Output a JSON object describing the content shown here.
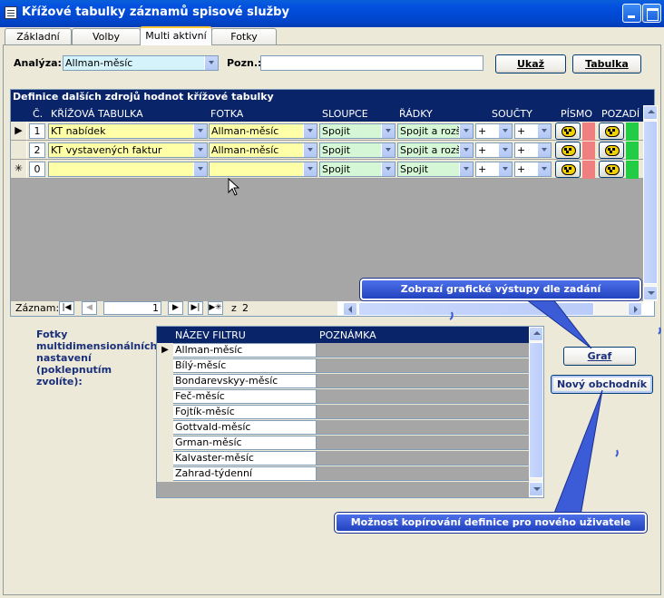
{
  "window": {
    "title": "Křížové tabulky záznamů spisové služby"
  },
  "tabs": [
    {
      "label": "Základní"
    },
    {
      "label": "Volby"
    },
    {
      "label": "Multi aktivní"
    },
    {
      "label": "Fotky"
    }
  ],
  "top": {
    "analyza_label": "Analýza:",
    "analyza_value": "Allman-měsíc",
    "pozn_label": "Pozn.:",
    "pozn_value": "",
    "ukaz_label": "Ukaž",
    "tabulka_label": "Tabulka"
  },
  "subform": {
    "title": "Definice dalších zdrojů hodnot křížové tabulky",
    "columns": {
      "c": "Č.",
      "krizova": "KŘÍŽOVÁ TABULKA",
      "fotka": "FOTKA",
      "sloupce": "SLOUPCE",
      "radky": "ŘÁDKY",
      "soucty": "SOUČTY",
      "pismo": "PÍSMO",
      "pozadi": "POZADÍ"
    },
    "rows": [
      {
        "selector": "▶",
        "num": "1",
        "krizova": "KT nabídek",
        "fotka": "Allman-měsíc",
        "sloupce": "Spojit",
        "radky": "Spojit a rozšíř",
        "soucet1": "+",
        "soucet2": "+"
      },
      {
        "selector": "",
        "num": "2",
        "krizova": "KT vystavených faktur",
        "fotka": "Allman-měsíc",
        "sloupce": "Spojit",
        "radky": "Spojit a rozšíř",
        "soucet1": "+",
        "soucet2": "+"
      },
      {
        "selector": "✳",
        "num": "0",
        "krizova": "",
        "fotka": "",
        "sloupce": "Spojit",
        "radky": "Spojit",
        "soucet1": "+",
        "soucet2": "+"
      }
    ],
    "nav": {
      "label": "Záznam:",
      "current": "1",
      "of": "z",
      "total": "2"
    }
  },
  "fotky": {
    "label": "Fotky multidimensionálních nastavení (poklepnutím zvolíte):",
    "columns": {
      "name": "NÁZEV FILTRU",
      "note": "POZNÁMKA"
    },
    "rows": [
      {
        "name": "Allman-měsíc",
        "selected": true
      },
      {
        "name": "Bílý-měsíc"
      },
      {
        "name": "Bondarevskyy-měsíc"
      },
      {
        "name": "Feč-měsíc"
      },
      {
        "name": "Fojtík-měsíc"
      },
      {
        "name": "Gottvald-měsíc"
      },
      {
        "name": "Grman-měsíc"
      },
      {
        "name": "Kalvaster-měsíc"
      },
      {
        "name": "Zahrad-týdenní"
      }
    ]
  },
  "buttons": {
    "graf": "Graf",
    "novy": "Nový obchodník"
  },
  "callouts": {
    "graf_tip": "Zobrazí grafické výstupy dle zadání",
    "novy_tip": "Možnost kopírování definice pro nového uživatele"
  },
  "colors": {
    "pismo_swatch": "#F08080",
    "pozadi_swatch": "#22CC44",
    "header_bg": "#0A246A"
  }
}
